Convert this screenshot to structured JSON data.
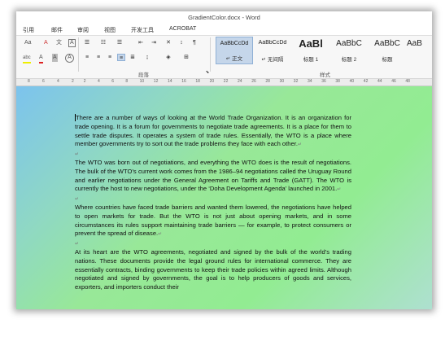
{
  "window": {
    "title": "GradientColor.docx - Word"
  },
  "menu": [
    "引用",
    "邮件",
    "审阅",
    "视图",
    "开发工具",
    "ACROBAT"
  ],
  "ribbon": {
    "font_row1": [
      "Aa",
      "A",
      "文",
      "A"
    ],
    "font_row2": [
      "abc",
      "A",
      "A",
      "A"
    ],
    "para_label": "段落",
    "styles_label": "样式",
    "styles": [
      {
        "preview": "AaBbCcDd",
        "name": "正文",
        "selected": true
      },
      {
        "preview": "AaBbCcDd",
        "name": "无间隔"
      },
      {
        "preview": "AaBl",
        "name": "标题 1"
      },
      {
        "preview": "AaBbC",
        "name": "标题 2"
      },
      {
        "preview": "AaBbC",
        "name": "标题"
      },
      {
        "preview": "AaB",
        "name": ""
      }
    ]
  },
  "ruler": [
    "8",
    "6",
    "4",
    "2",
    "2",
    "4",
    "6",
    "8",
    "10",
    "12",
    "14",
    "16",
    "18",
    "20",
    "22",
    "24",
    "26",
    "28",
    "30",
    "32",
    "34",
    "36",
    "38",
    "40",
    "42",
    "44",
    "46",
    "48"
  ],
  "document": {
    "paragraphs": [
      "There are a number of ways of looking at the World Trade Organization. It is an organization for trade opening. It is a forum for governments to negotiate trade agreements. It is a place for them to settle trade disputes. It operates a system of trade rules. Essentially, the WTO is a place where member governments try to sort out the trade problems they face with each other.",
      "The WTO was born out of negotiations, and everything the WTO does is the result of negotiations. The bulk of the WTO’s current work comes from the 1986–94 negotiations called the Uruguay Round and earlier negotiations under the General Agreement on Tariffs and Trade (GATT). The WTO is currently the host to new negotiations, under the ‘Doha Development Agenda’ launched in 2001.",
      "Where countries have faced trade barriers and wanted them lowered, the negotiations have helped to open markets for trade. But the WTO is not just about opening markets, and in some circumstances its rules support maintaining trade barriers — for example, to protect consumers or prevent the spread of disease.",
      "At its heart are the WTO agreements, negotiated and signed by the bulk of the world’s trading nations. These documents provide the legal ground rules for international commerce. They are essentially contracts, binding governments to keep their trade policies within agreed limits. Although negotiated and signed by governments, the goal is to help producers of goods and services, exporters, and importers conduct their"
    ]
  }
}
